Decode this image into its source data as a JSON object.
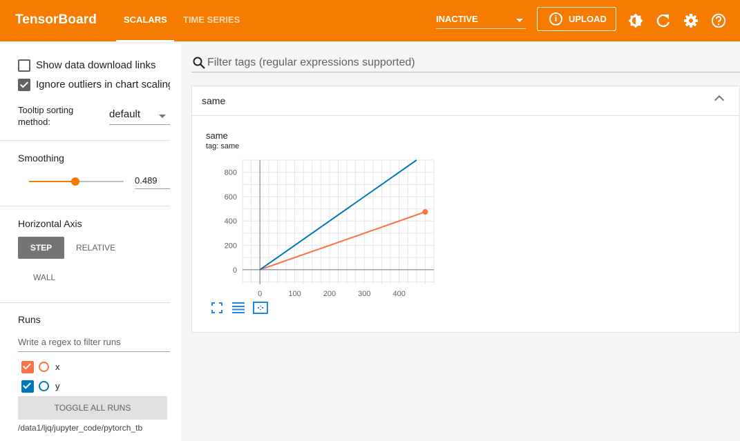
{
  "app": {
    "brand": "TensorBoard",
    "tabs": [
      {
        "label": "SCALARS",
        "active": true
      },
      {
        "label": "TIME SERIES",
        "active": false
      }
    ],
    "reload_status": "INACTIVE",
    "upload_label": "UPLOAD",
    "upload_icon_glyph": "i",
    "icons": [
      "brightness-icon",
      "refresh-icon",
      "settings-icon",
      "help-icon"
    ],
    "colors": {
      "header": "#f57c00",
      "run_x": "#ff7043",
      "run_y": "#0077bb"
    }
  },
  "sidebar": {
    "options": [
      {
        "label": "Show data download links",
        "checked": false
      },
      {
        "label": "Ignore outliers in chart scaling",
        "checked": true
      }
    ],
    "tooltip_sorting": {
      "label": "Tooltip sorting method:",
      "value": "default"
    },
    "smoothing": {
      "label": "Smoothing",
      "value": "0.489",
      "fraction": 0.489
    },
    "horizontal_axis": {
      "label": "Horizontal Axis",
      "options": [
        "STEP",
        "RELATIVE",
        "WALL"
      ],
      "selected": "STEP"
    },
    "runs": {
      "label": "Runs",
      "filter_placeholder": "Write a regex to filter runs",
      "items": [
        {
          "name": "x",
          "checked": true,
          "color": "#ff7043"
        },
        {
          "name": "y",
          "checked": true,
          "color": "#0077bb"
        }
      ],
      "toggle_all_label": "TOGGLE ALL RUNS",
      "logdir": "/data1/ljq/jupyter_code/pytorch_tb"
    }
  },
  "main": {
    "filter_placeholder": "Filter tags (regular expressions supported)",
    "groups": [
      {
        "title": "same",
        "cards": [
          {
            "title": "same",
            "tag": "tag: same"
          }
        ]
      }
    ]
  },
  "chart_data": {
    "type": "line",
    "title": "same",
    "subtitle": "tag: same",
    "xlabel": "",
    "ylabel": "",
    "xlim": [
      -50,
      500
    ],
    "ylim": [
      -120,
      900
    ],
    "x_ticks": [
      0,
      100,
      200,
      300,
      400
    ],
    "y_ticks": [
      0,
      200,
      400,
      600,
      800
    ],
    "grid": true,
    "series": [
      {
        "name": "x",
        "color": "#ff7043",
        "x": [
          0,
          475
        ],
        "y": [
          0,
          475
        ],
        "end_marker": true
      },
      {
        "name": "y",
        "color": "#0077bb",
        "x": [
          0,
          450
        ],
        "y": [
          0,
          900
        ],
        "end_marker": false
      }
    ]
  }
}
